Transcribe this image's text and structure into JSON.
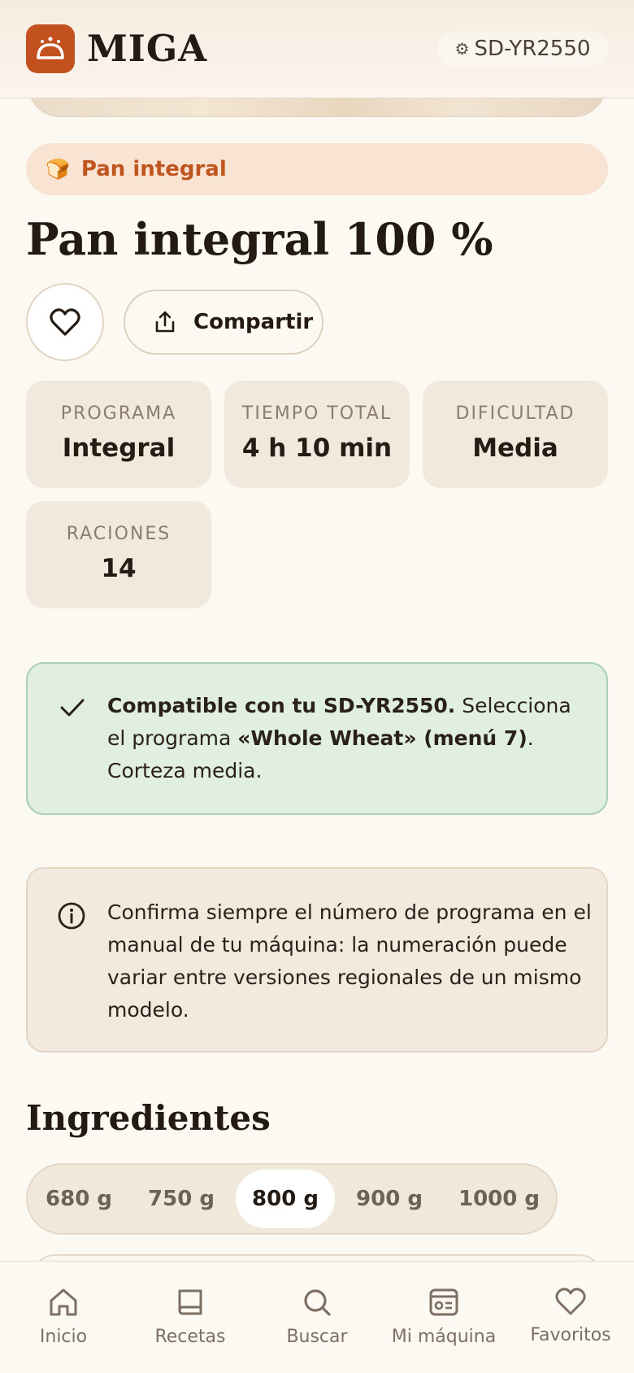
{
  "header": {
    "brand": "MIGA",
    "device_icon": "gear-icon",
    "device": "SD-YR2550"
  },
  "category": {
    "icon": "bread-icon",
    "label": "Pan integral"
  },
  "recipe": {
    "title": "Pan integral 100 %",
    "share_label": "Compartir"
  },
  "stats": [
    {
      "label": "PROGRAMA",
      "value": "Integral"
    },
    {
      "label": "TIEMPO TOTAL",
      "value": "4 h 10 min"
    },
    {
      "label": "DIFICULTAD",
      "value": "Media"
    },
    {
      "label": "RACIONES",
      "value": "14"
    }
  ],
  "compat": {
    "bold": "Compatible con tu SD-YR2550.",
    "text1": " Selecciona el programa ",
    "program": "«Whole Wheat» (menú 7)",
    "text2": ". Corteza media."
  },
  "info": {
    "text": "Confirma siempre el número de programa en el manual de tu máquina: la numeración puede variar entre versiones regionales de un mismo modelo."
  },
  "ingredients": {
    "title": "Ingredientes",
    "sizes": [
      "680 g",
      "750 g",
      "800 g",
      "900 g",
      "1000 g"
    ],
    "selected": "800 g"
  },
  "nav": [
    {
      "icon": "home-icon",
      "label": "Inicio"
    },
    {
      "icon": "book-icon",
      "label": "Recetas"
    },
    {
      "icon": "search-icon",
      "label": "Buscar"
    },
    {
      "icon": "machine-icon",
      "label": "Mi máquina"
    },
    {
      "icon": "heart-icon",
      "label": "Favoritos"
    }
  ],
  "colors": {
    "accent": "#c2511f",
    "background": "#fcf8f2",
    "success_bg": "#e1eee2",
    "chip_bg": "#f9e3d2"
  }
}
